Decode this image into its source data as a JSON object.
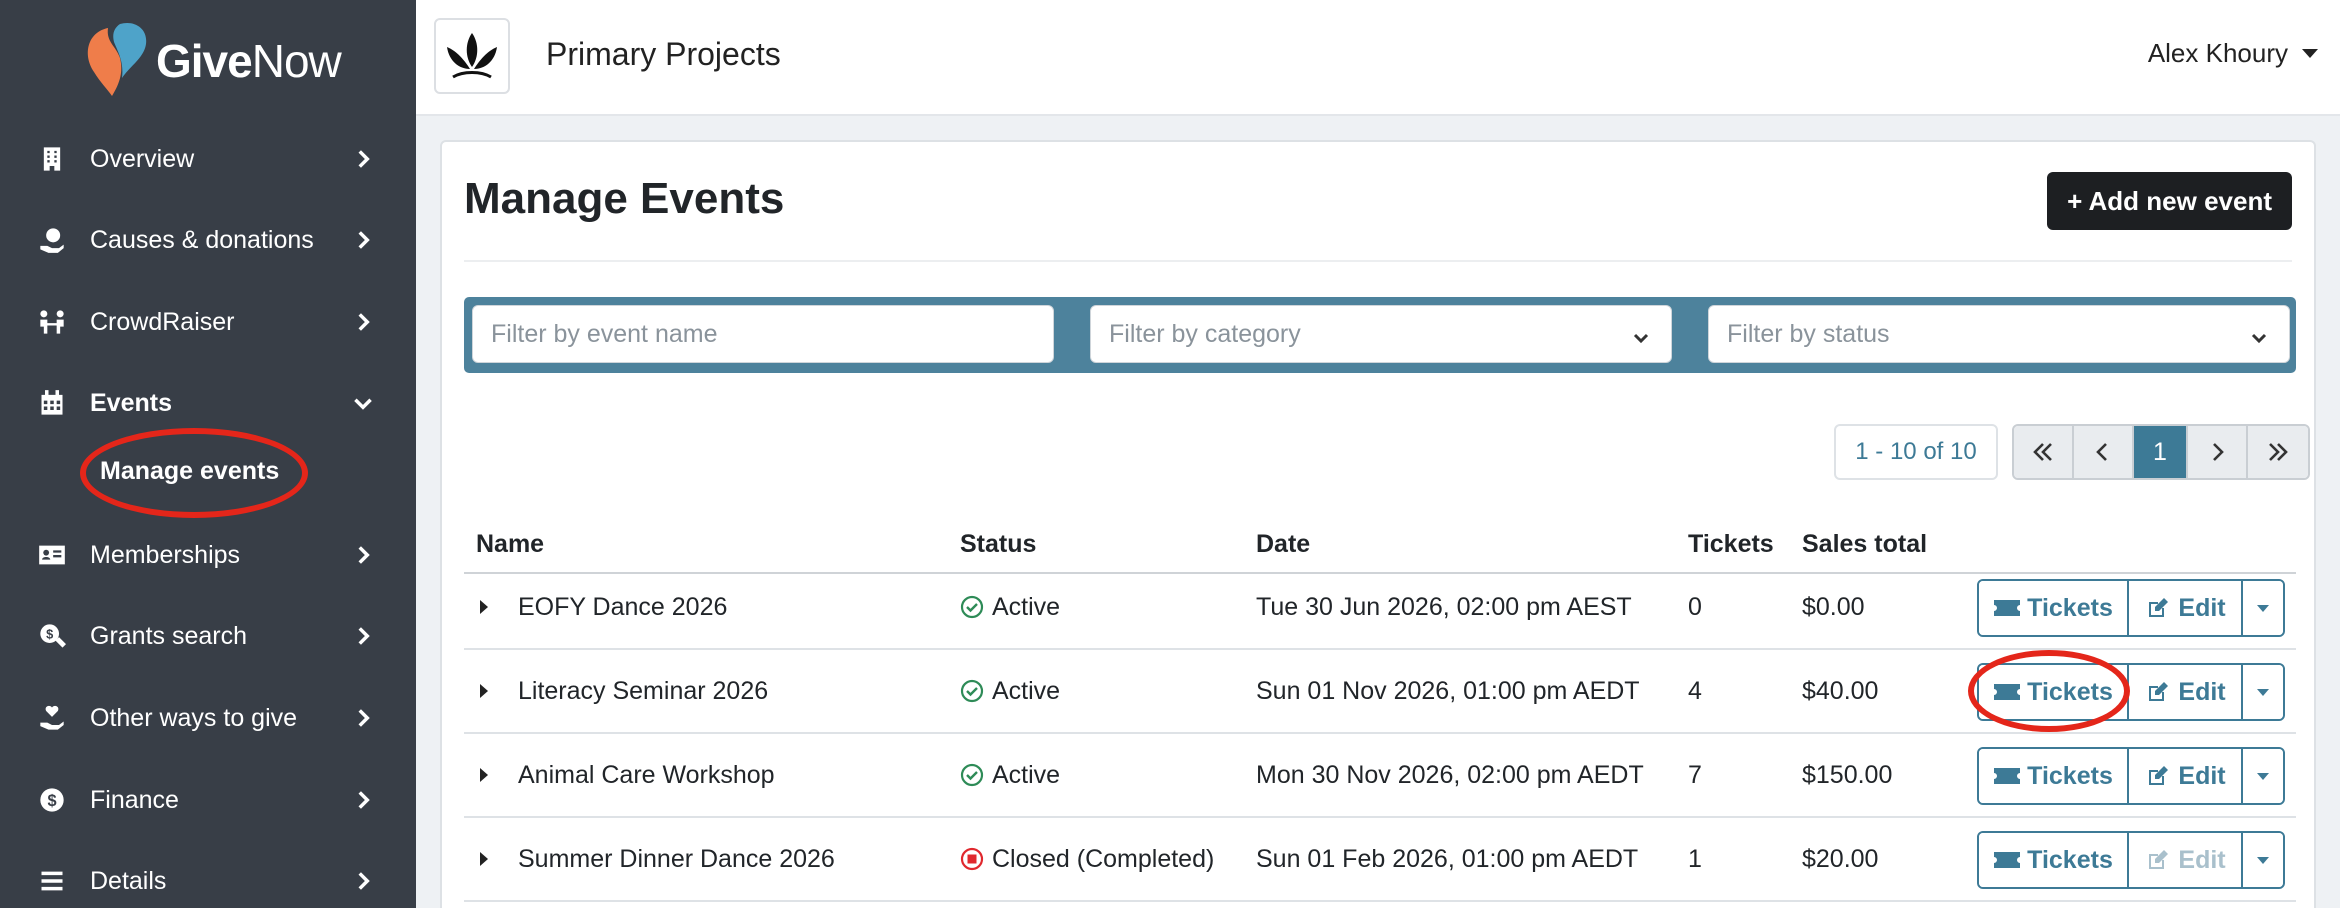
{
  "brand": {
    "name_give": "Give",
    "name_now": "Now"
  },
  "sidebar": {
    "items": [
      {
        "label": "Overview",
        "icon": "building-icon"
      },
      {
        "label": "Causes & donations",
        "icon": "hand-coin-icon"
      },
      {
        "label": "CrowdRaiser",
        "icon": "people-icon"
      },
      {
        "label": "Events",
        "icon": "calendar-icon"
      },
      {
        "label": "Memberships",
        "icon": "id-card-icon"
      },
      {
        "label": "Grants search",
        "icon": "search-dollar-icon"
      },
      {
        "label": "Other ways to give",
        "icon": "hand-heart-icon"
      },
      {
        "label": "Finance",
        "icon": "dollar-icon"
      },
      {
        "label": "Details",
        "icon": "list-icon"
      }
    ],
    "sub_item": "Manage events"
  },
  "header": {
    "org_name": "Primary Projects",
    "user_name": "Alex Khoury"
  },
  "main": {
    "title": "Manage Events",
    "add_button": "+ Add new event",
    "filters": {
      "name_placeholder": "Filter by event name",
      "category_placeholder": "Filter by category",
      "status_placeholder": "Filter by status"
    },
    "pagination": {
      "range": "1 - 10 of 10",
      "current_page": "1"
    },
    "table": {
      "columns": [
        "Name",
        "Status",
        "Date",
        "Tickets",
        "Sales total"
      ],
      "rows": [
        {
          "name": "EOFY Dance 2026",
          "status": "Active",
          "status_type": "active",
          "date": "Tue 30 Jun 2026, 02:00 pm AEST",
          "tickets": "0",
          "sales": "$0.00",
          "edit_enabled": true
        },
        {
          "name": "Literacy Seminar 2026",
          "status": "Active",
          "status_type": "active",
          "date": "Sun 01 Nov 2026, 01:00 pm AEDT",
          "tickets": "4",
          "sales": "$40.00",
          "edit_enabled": true
        },
        {
          "name": "Animal Care Workshop",
          "status": "Active",
          "status_type": "active",
          "date": "Mon 30 Nov 2026, 02:00 pm AEDT",
          "tickets": "7",
          "sales": "$150.00",
          "edit_enabled": true
        },
        {
          "name": "Summer Dinner Dance 2026",
          "status": "Closed (Completed)",
          "status_type": "closed",
          "date": "Sun 01 Feb 2026, 01:00 pm AEDT",
          "tickets": "1",
          "sales": "$20.00",
          "edit_enabled": false
        }
      ],
      "tickets_label": "Tickets",
      "edit_label": "Edit"
    }
  },
  "colors": {
    "sidebar_bg": "#383e47",
    "accent": "#3d7a96",
    "active_green": "#2e8b57",
    "closed_red": "#e0282e",
    "annotation_red": "#e4261a"
  }
}
